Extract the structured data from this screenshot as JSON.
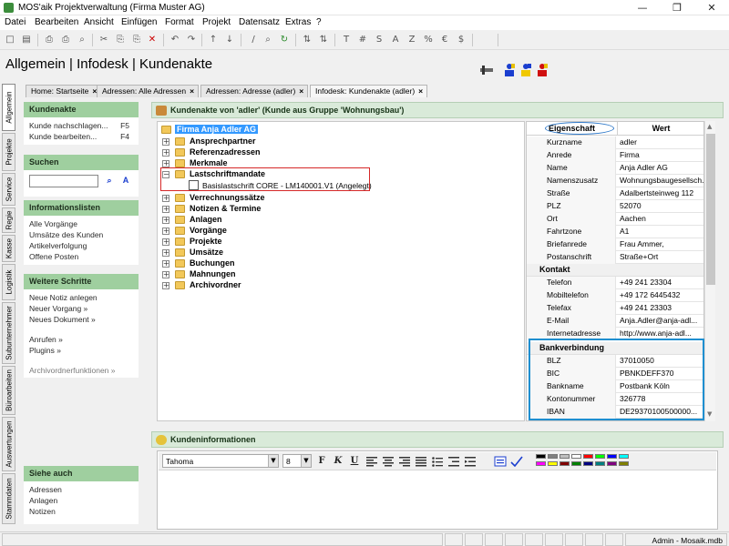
{
  "window": {
    "title": "MOS'aik Projektverwaltung (Firma Muster AG)",
    "controls": [
      "—",
      "❒",
      "✕"
    ]
  },
  "menu": [
    "Datei",
    "Bearbeiten",
    "Ansicht",
    "Einfügen",
    "Format",
    "Projekt",
    "Datensatz",
    "Extras",
    "?"
  ],
  "toolbar_glyphs": [
    "□",
    "▤",
    "⎙",
    "⎙",
    "⌕",
    "✂",
    "⎘",
    "⎘",
    "✕",
    "↶",
    "↷",
    "↑",
    "↓",
    "/",
    "⌕",
    "↻",
    "⇅",
    "⇅",
    "T",
    "#",
    "S",
    "A",
    "Z",
    "%",
    "€",
    "$"
  ],
  "breadcrumb": "Allgemein | Infodesk | Kundenakte",
  "side_tabs": [
    "Allgemein",
    "Projekte",
    "Service",
    "Regie",
    "Kasse",
    "Logistik",
    "Subunternehmer",
    "Büroarbeiten",
    "Auswertungen",
    "Stammdaten"
  ],
  "doc_tabs": [
    "Home: Startseite",
    "Adressen: Alle Adressen",
    "Adressen: Adresse (adler)",
    "Infodesk: Kundenakte (adler)"
  ],
  "left_panel": {
    "kundenakte": {
      "title": "Kundenakte",
      "items": [
        {
          "label": "Kunde nachschlagen...",
          "key": "F5"
        },
        {
          "label": "Kunde bearbeiten...",
          "key": "F4"
        }
      ]
    },
    "suchen": {
      "title": "Suchen"
    },
    "informationslisten": {
      "title": "Informationslisten",
      "items": [
        "Alle Vorgänge",
        "Umsätze des Kunden",
        "Artikelverfolgung",
        "Offene Posten"
      ]
    },
    "weitere": {
      "title": "Weitere Schritte",
      "items": [
        "Neue Notiz anlegen",
        "Neuer Vorgang »",
        "Neues Dokument »"
      ],
      "items2": [
        "Anrufen »",
        "Plugins »"
      ],
      "muted": "Archivordnerfunktionen »"
    },
    "siehe_auch": {
      "title": "Siehe auch",
      "items": [
        "Adressen",
        "Anlagen",
        "Notizen"
      ]
    }
  },
  "main_header": "Kundenakte von 'adler' (Kunde aus Gruppe 'Wohnungsbau')",
  "tree": {
    "root": "Firma Anja Adler AG",
    "nodes": [
      "Ansprechpartner",
      "Referenzadressen",
      "Merkmale",
      "Lastschriftmandate",
      "Verrechnungssätze",
      "Notizen & Termine",
      "Anlagen",
      "Vorgänge",
      "Projekte",
      "Umsätze",
      "Buchungen",
      "Mahnungen",
      "Archivordner"
    ],
    "leaf": "Basislastschrift CORE - LM140001.V1 (Angelegt)"
  },
  "props": {
    "headers": [
      "Eigenschaft",
      "Wert"
    ],
    "rows": [
      {
        "k": "Kurzname",
        "v": "adler"
      },
      {
        "k": "Anrede",
        "v": "Firma"
      },
      {
        "k": "Name",
        "v": "Anja Adler AG"
      },
      {
        "k": "Namenszusatz",
        "v": "Wohnungsbaugesellsch..."
      },
      {
        "k": "Straße",
        "v": "Adalbertsteinweg 112"
      },
      {
        "k": "PLZ",
        "v": "52070"
      },
      {
        "k": "Ort",
        "v": "Aachen"
      },
      {
        "k": "Fahrtzone",
        "v": "A1"
      },
      {
        "k": "Briefanrede",
        "v": "Frau Ammer,"
      },
      {
        "k": "Postanschrift",
        "v": "Straße+Ort"
      }
    ],
    "cat_kontakt": "Kontakt",
    "kontakt": [
      {
        "k": "Telefon",
        "v": "+49 241 23304"
      },
      {
        "k": "Mobiltelefon",
        "v": "+49 172 6445432"
      },
      {
        "k": "Telefax",
        "v": "+49 241 23303"
      },
      {
        "k": "E-Mail",
        "v": "Anja.Adler@anja-adl..."
      },
      {
        "k": "Internetadresse",
        "v": "http://www.anja-adl..."
      }
    ],
    "cat_bank": "Bankverbindung",
    "bank": [
      {
        "k": "BLZ",
        "v": "37010050"
      },
      {
        "k": "BIC",
        "v": "PBNKDEFF370"
      },
      {
        "k": "Bankname",
        "v": "Postbank Köln"
      },
      {
        "k": "Kontonummer",
        "v": "326778"
      },
      {
        "k": "IBAN",
        "v": "DE29370100500000..."
      }
    ]
  },
  "kundeninfo": {
    "title": "Kundeninformationen",
    "font": "Tahoma",
    "size": "8",
    "format_glyphs": [
      "F",
      "K",
      "U"
    ],
    "colors": [
      "#000000",
      "#808080",
      "#c0c0c0",
      "#ffffff",
      "#ff0000",
      "#00ff00",
      "#0000ff",
      "#00ffff",
      "#ff00ff",
      "#ffff00",
      "#800000",
      "#008000",
      "#000080",
      "#008080",
      "#800080",
      "#808000"
    ]
  },
  "status": {
    "db": "Admin - Mosaik.mdb"
  }
}
